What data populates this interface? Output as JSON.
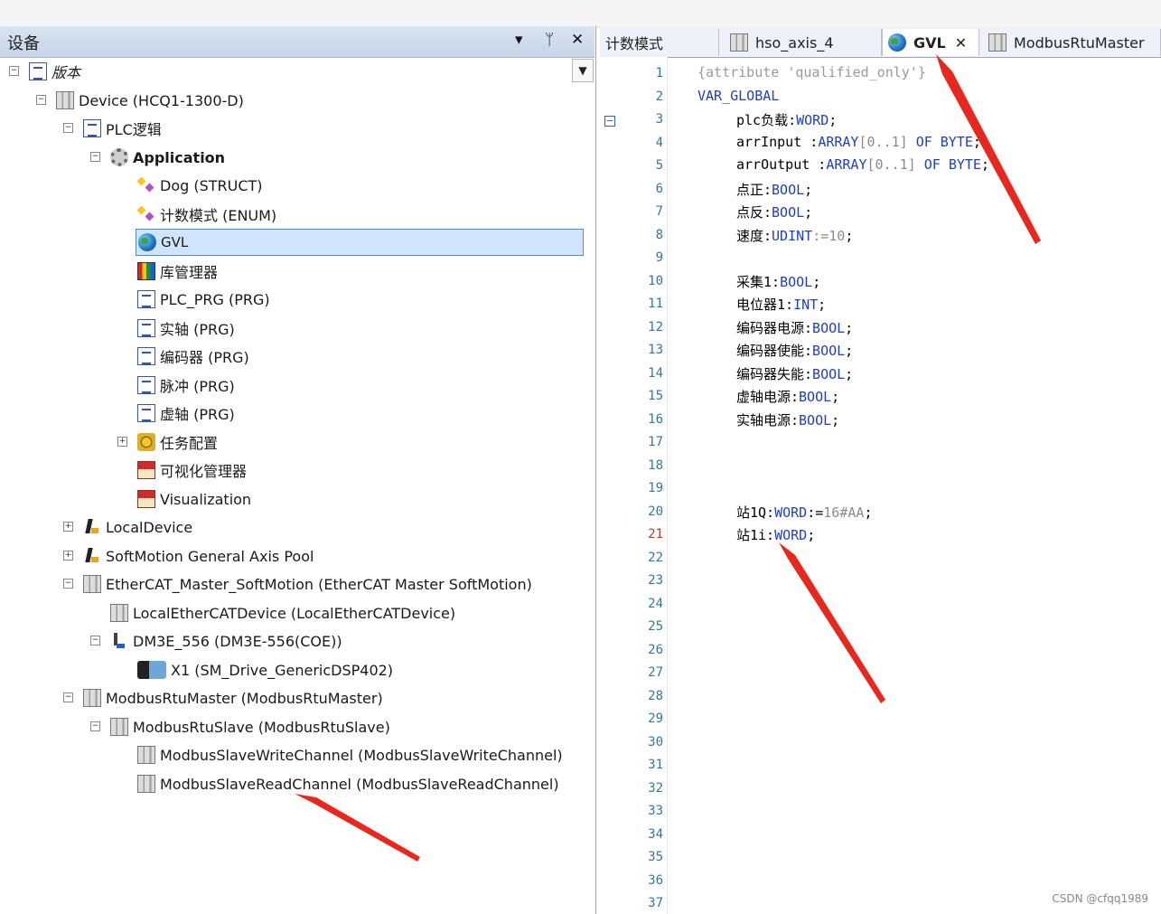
{
  "left_panel": {
    "title": "设备",
    "buttons": {
      "dropdown": "▾",
      "pin": "ᛘ",
      "close": "✕"
    },
    "tree": [
      {
        "label": "版本"
      },
      {
        "label": "Device (HCQ1-1300-D)"
      },
      {
        "label": "PLC逻辑"
      },
      {
        "label": "Application"
      },
      {
        "label": "Dog (STRUCT)"
      },
      {
        "label": "计数模式 (ENUM)"
      },
      {
        "label": "GVL"
      },
      {
        "label": "库管理器"
      },
      {
        "label": "PLC_PRG (PRG)"
      },
      {
        "label": "实轴 (PRG)"
      },
      {
        "label": "编码器 (PRG)"
      },
      {
        "label": "脉冲 (PRG)"
      },
      {
        "label": "虚轴 (PRG)"
      },
      {
        "label": "任务配置"
      },
      {
        "label": "可视化管理器"
      },
      {
        "label": "Visualization"
      },
      {
        "label": "LocalDevice"
      },
      {
        "label": "SoftMotion General Axis Pool"
      },
      {
        "label": "EtherCAT_Master_SoftMotion (EtherCAT Master SoftMotion)"
      },
      {
        "label": "LocalEtherCATDevice (LocalEtherCATDevice)"
      },
      {
        "label": "DM3E_556 (DM3E-556(COE))"
      },
      {
        "label": "X1 (SM_Drive_GenericDSP402)"
      },
      {
        "label": "ModbusRtuMaster (ModbusRtuMaster)"
      },
      {
        "label": "ModbusRtuSlave (ModbusRtuSlave)"
      },
      {
        "label": "ModbusSlaveWriteChannel (ModbusSlaveWriteChannel)"
      },
      {
        "label": "ModbusSlaveReadChannel (ModbusSlaveReadChannel)"
      }
    ],
    "selected": "GVL"
  },
  "editor": {
    "tabs": [
      {
        "label": "计数模式"
      },
      {
        "label": "hso_axis_4"
      },
      {
        "label": "GVL",
        "close": "✕"
      },
      {
        "label": "ModbusRtuMaster"
      }
    ],
    "active_tab": "GVL",
    "line_numbers": [
      "1",
      "2",
      "3",
      "4",
      "5",
      "6",
      "7",
      "8",
      "9",
      "10",
      "11",
      "12",
      "13",
      "14",
      "15",
      "16",
      "17",
      "18",
      "19",
      "20",
      "21",
      "22",
      "23",
      "24",
      "25",
      "26",
      "27",
      "28",
      "29",
      "30",
      "31",
      "32",
      "33",
      "34",
      "35",
      "36",
      "37"
    ],
    "current_line": "21",
    "fold_marker": "−",
    "lines": [
      {
        "n": 1,
        "text": "{attribute 'qualified_only'}"
      },
      {
        "n": 2,
        "text": "VAR_GLOBAL"
      },
      {
        "n": 3,
        "text": "plc负载:WORD;"
      },
      {
        "n": 4,
        "text": "arrInput :ARRAY[0..1] OF BYTE;"
      },
      {
        "n": 5,
        "text": "arrOutput :ARRAY[0..1] OF BYTE;"
      },
      {
        "n": 6,
        "text": "点正:BOOL;"
      },
      {
        "n": 7,
        "text": "点反:BOOL;"
      },
      {
        "n": 8,
        "text": "速度:UDINT:=10;"
      },
      {
        "n": 10,
        "text": "采集1:BOOL;"
      },
      {
        "n": 11,
        "text": "电位器1:INT;"
      },
      {
        "n": 12,
        "text": "编码器电源:BOOL;"
      },
      {
        "n": 13,
        "text": "编码器使能:BOOL;"
      },
      {
        "n": 14,
        "text": "编码器失能:BOOL;"
      },
      {
        "n": 15,
        "text": "虚轴电源:BOOL;"
      },
      {
        "n": 16,
        "text": "实轴电源:BOOL;"
      },
      {
        "n": 20,
        "text": "站1Q:WORD:=16#AA;"
      },
      {
        "n": 21,
        "text": "站1i:WORD;"
      }
    ]
  },
  "watermark": "CSDN @cfqq1989",
  "colors": {
    "annotation_arrow": "#e8281e",
    "selection": "#cfe5fb",
    "keyword": "#1f3fbf",
    "line_number": "#2f7a9a"
  }
}
